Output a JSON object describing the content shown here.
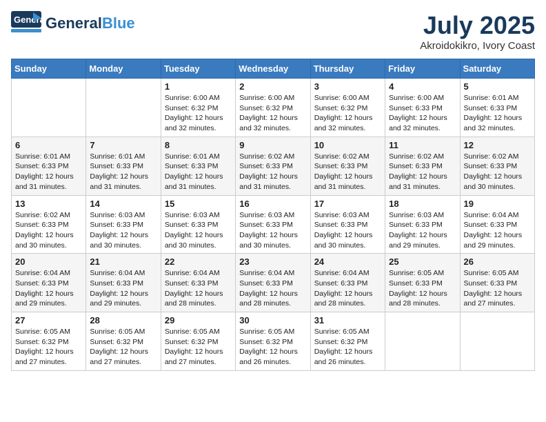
{
  "header": {
    "logo_general": "General",
    "logo_blue": "Blue",
    "month": "July 2025",
    "location": "Akroidokikro, Ivory Coast"
  },
  "weekdays": [
    "Sunday",
    "Monday",
    "Tuesday",
    "Wednesday",
    "Thursday",
    "Friday",
    "Saturday"
  ],
  "weeks": [
    [
      {
        "day": "",
        "sunrise": "",
        "sunset": "",
        "daylight": ""
      },
      {
        "day": "",
        "sunrise": "",
        "sunset": "",
        "daylight": ""
      },
      {
        "day": "1",
        "sunrise": "Sunrise: 6:00 AM",
        "sunset": "Sunset: 6:32 PM",
        "daylight": "Daylight: 12 hours and 32 minutes."
      },
      {
        "day": "2",
        "sunrise": "Sunrise: 6:00 AM",
        "sunset": "Sunset: 6:32 PM",
        "daylight": "Daylight: 12 hours and 32 minutes."
      },
      {
        "day": "3",
        "sunrise": "Sunrise: 6:00 AM",
        "sunset": "Sunset: 6:32 PM",
        "daylight": "Daylight: 12 hours and 32 minutes."
      },
      {
        "day": "4",
        "sunrise": "Sunrise: 6:00 AM",
        "sunset": "Sunset: 6:33 PM",
        "daylight": "Daylight: 12 hours and 32 minutes."
      },
      {
        "day": "5",
        "sunrise": "Sunrise: 6:01 AM",
        "sunset": "Sunset: 6:33 PM",
        "daylight": "Daylight: 12 hours and 32 minutes."
      }
    ],
    [
      {
        "day": "6",
        "sunrise": "Sunrise: 6:01 AM",
        "sunset": "Sunset: 6:33 PM",
        "daylight": "Daylight: 12 hours and 31 minutes."
      },
      {
        "day": "7",
        "sunrise": "Sunrise: 6:01 AM",
        "sunset": "Sunset: 6:33 PM",
        "daylight": "Daylight: 12 hours and 31 minutes."
      },
      {
        "day": "8",
        "sunrise": "Sunrise: 6:01 AM",
        "sunset": "Sunset: 6:33 PM",
        "daylight": "Daylight: 12 hours and 31 minutes."
      },
      {
        "day": "9",
        "sunrise": "Sunrise: 6:02 AM",
        "sunset": "Sunset: 6:33 PM",
        "daylight": "Daylight: 12 hours and 31 minutes."
      },
      {
        "day": "10",
        "sunrise": "Sunrise: 6:02 AM",
        "sunset": "Sunset: 6:33 PM",
        "daylight": "Daylight: 12 hours and 31 minutes."
      },
      {
        "day": "11",
        "sunrise": "Sunrise: 6:02 AM",
        "sunset": "Sunset: 6:33 PM",
        "daylight": "Daylight: 12 hours and 31 minutes."
      },
      {
        "day": "12",
        "sunrise": "Sunrise: 6:02 AM",
        "sunset": "Sunset: 6:33 PM",
        "daylight": "Daylight: 12 hours and 30 minutes."
      }
    ],
    [
      {
        "day": "13",
        "sunrise": "Sunrise: 6:02 AM",
        "sunset": "Sunset: 6:33 PM",
        "daylight": "Daylight: 12 hours and 30 minutes."
      },
      {
        "day": "14",
        "sunrise": "Sunrise: 6:03 AM",
        "sunset": "Sunset: 6:33 PM",
        "daylight": "Daylight: 12 hours and 30 minutes."
      },
      {
        "day": "15",
        "sunrise": "Sunrise: 6:03 AM",
        "sunset": "Sunset: 6:33 PM",
        "daylight": "Daylight: 12 hours and 30 minutes."
      },
      {
        "day": "16",
        "sunrise": "Sunrise: 6:03 AM",
        "sunset": "Sunset: 6:33 PM",
        "daylight": "Daylight: 12 hours and 30 minutes."
      },
      {
        "day": "17",
        "sunrise": "Sunrise: 6:03 AM",
        "sunset": "Sunset: 6:33 PM",
        "daylight": "Daylight: 12 hours and 30 minutes."
      },
      {
        "day": "18",
        "sunrise": "Sunrise: 6:03 AM",
        "sunset": "Sunset: 6:33 PM",
        "daylight": "Daylight: 12 hours and 29 minutes."
      },
      {
        "day": "19",
        "sunrise": "Sunrise: 6:04 AM",
        "sunset": "Sunset: 6:33 PM",
        "daylight": "Daylight: 12 hours and 29 minutes."
      }
    ],
    [
      {
        "day": "20",
        "sunrise": "Sunrise: 6:04 AM",
        "sunset": "Sunset: 6:33 PM",
        "daylight": "Daylight: 12 hours and 29 minutes."
      },
      {
        "day": "21",
        "sunrise": "Sunrise: 6:04 AM",
        "sunset": "Sunset: 6:33 PM",
        "daylight": "Daylight: 12 hours and 29 minutes."
      },
      {
        "day": "22",
        "sunrise": "Sunrise: 6:04 AM",
        "sunset": "Sunset: 6:33 PM",
        "daylight": "Daylight: 12 hours and 28 minutes."
      },
      {
        "day": "23",
        "sunrise": "Sunrise: 6:04 AM",
        "sunset": "Sunset: 6:33 PM",
        "daylight": "Daylight: 12 hours and 28 minutes."
      },
      {
        "day": "24",
        "sunrise": "Sunrise: 6:04 AM",
        "sunset": "Sunset: 6:33 PM",
        "daylight": "Daylight: 12 hours and 28 minutes."
      },
      {
        "day": "25",
        "sunrise": "Sunrise: 6:05 AM",
        "sunset": "Sunset: 6:33 PM",
        "daylight": "Daylight: 12 hours and 28 minutes."
      },
      {
        "day": "26",
        "sunrise": "Sunrise: 6:05 AM",
        "sunset": "Sunset: 6:33 PM",
        "daylight": "Daylight: 12 hours and 27 minutes."
      }
    ],
    [
      {
        "day": "27",
        "sunrise": "Sunrise: 6:05 AM",
        "sunset": "Sunset: 6:32 PM",
        "daylight": "Daylight: 12 hours and 27 minutes."
      },
      {
        "day": "28",
        "sunrise": "Sunrise: 6:05 AM",
        "sunset": "Sunset: 6:32 PM",
        "daylight": "Daylight: 12 hours and 27 minutes."
      },
      {
        "day": "29",
        "sunrise": "Sunrise: 6:05 AM",
        "sunset": "Sunset: 6:32 PM",
        "daylight": "Daylight: 12 hours and 27 minutes."
      },
      {
        "day": "30",
        "sunrise": "Sunrise: 6:05 AM",
        "sunset": "Sunset: 6:32 PM",
        "daylight": "Daylight: 12 hours and 26 minutes."
      },
      {
        "day": "31",
        "sunrise": "Sunrise: 6:05 AM",
        "sunset": "Sunset: 6:32 PM",
        "daylight": "Daylight: 12 hours and 26 minutes."
      },
      {
        "day": "",
        "sunrise": "",
        "sunset": "",
        "daylight": ""
      },
      {
        "day": "",
        "sunrise": "",
        "sunset": "",
        "daylight": ""
      }
    ]
  ]
}
